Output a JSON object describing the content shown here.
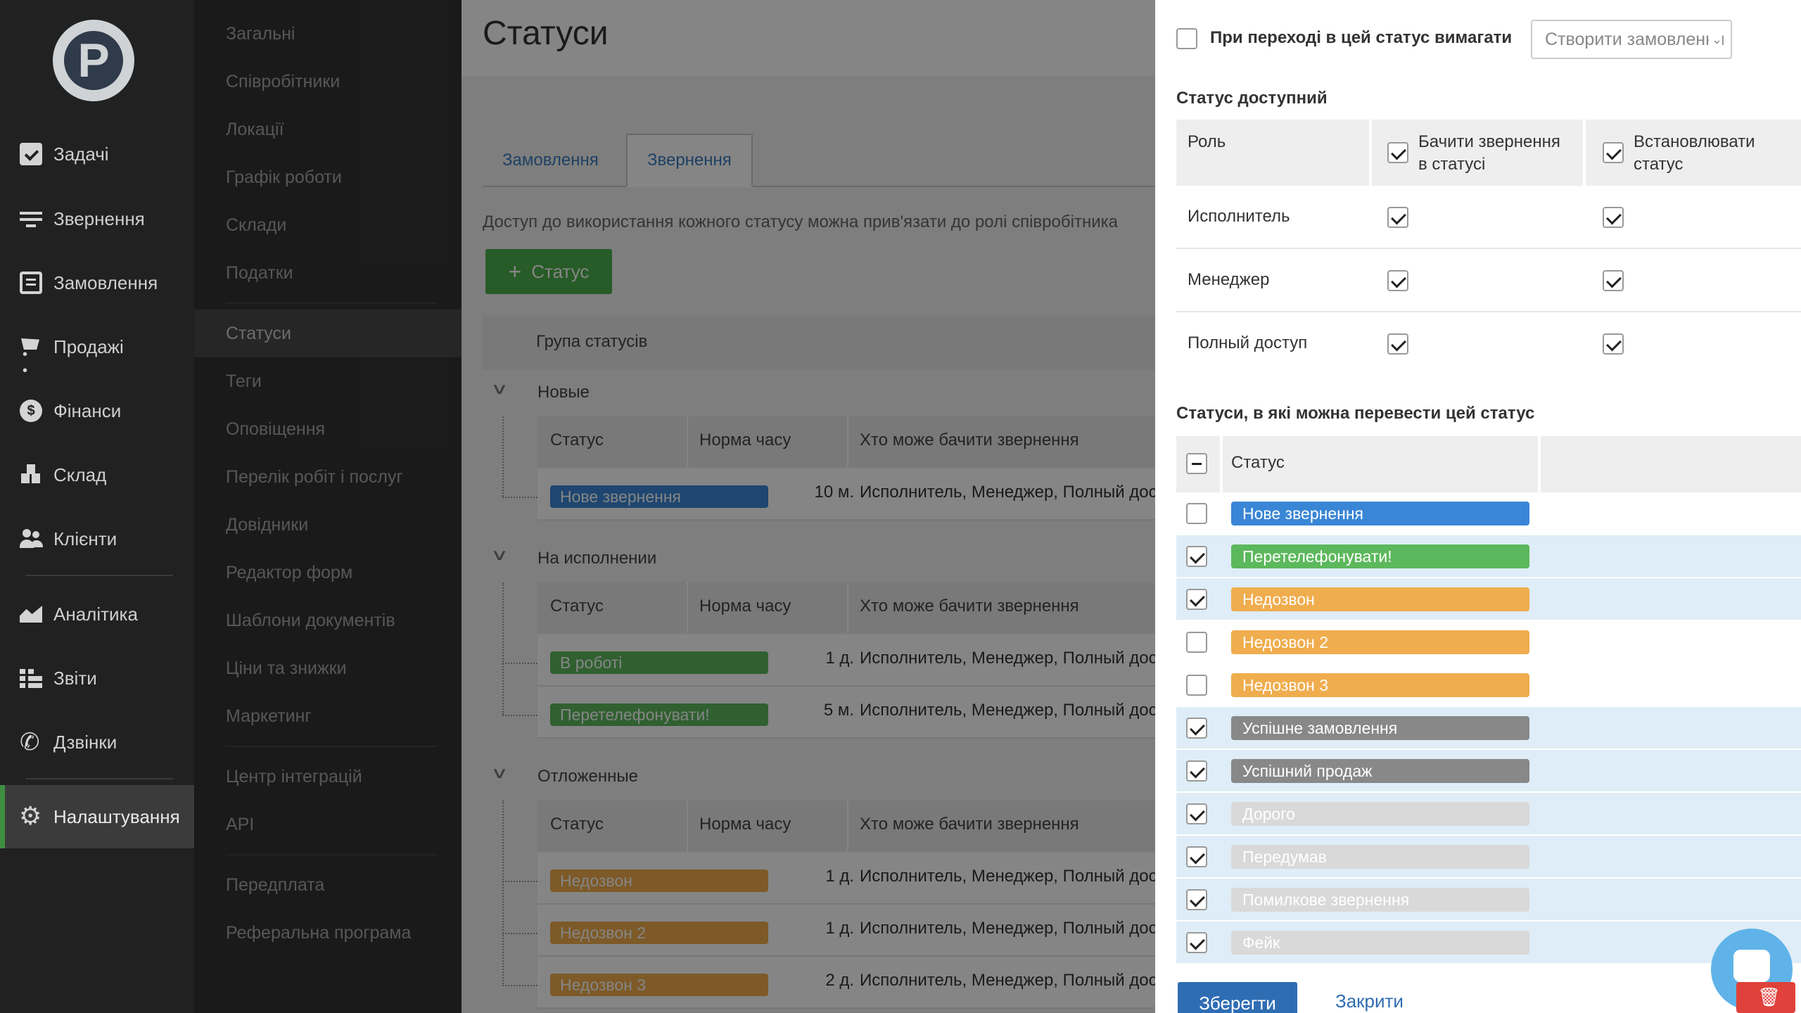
{
  "colors": {
    "accent_green": "#3e8e41",
    "blue": "#3a86d6",
    "green": "#5cb85c",
    "orange": "#f0ad4e",
    "grey_dark": "#888888",
    "grey_light": "#d9d9d9",
    "save_blue": "#2f6db3"
  },
  "nav": {
    "logo_icon": "logo-icon",
    "items": [
      {
        "label": "Задачі",
        "icon": "clipboard-check-icon"
      },
      {
        "label": "Звернення",
        "icon": "filter-icon"
      },
      {
        "label": "Замовлення",
        "icon": "document-icon"
      },
      {
        "label": "Продажі",
        "icon": "cart-icon"
      },
      {
        "label": "Фінанси",
        "icon": "coin-icon"
      },
      {
        "label": "Склад",
        "icon": "boxes-icon"
      },
      {
        "label": "Клієнти",
        "icon": "users-icon"
      },
      {
        "label": "Аналітика",
        "icon": "chart-icon"
      },
      {
        "label": "Звіти",
        "icon": "list-icon"
      },
      {
        "label": "Дзвінки",
        "icon": "phone-icon"
      },
      {
        "label": "Налаштування",
        "icon": "gear-icon"
      }
    ]
  },
  "submenu": {
    "items": [
      "Загальні",
      "Співробітники",
      "Локації",
      "Графік роботи",
      "Склади",
      "Податки",
      "Статуси",
      "Теги",
      "Оповіщення",
      "Перелік робіт і послуг",
      "Довідники",
      "Редактор форм",
      "Шаблони документів",
      "Ціни та знижки",
      "Маркетинг",
      "Центр інтеграцій",
      "API",
      "Передплата",
      "Реферальна програма"
    ],
    "active": "Статуси"
  },
  "main": {
    "title": "Статуси",
    "tabs": [
      "Замовлення",
      "Звернення"
    ],
    "active_tab": "Звернення",
    "help_text": "Доступ до використання кожного статусу можна прив'язати до ролі співробітника",
    "add_button": "Статус",
    "group_header": "Група статусів",
    "columns": {
      "status": "Статус",
      "norm": "Норма часу",
      "who": "Хто може бачити звернення"
    },
    "groups": [
      {
        "name": "Новые",
        "rows": [
          {
            "status": "Нове звернення",
            "color": "#3a86d6",
            "norm": "10 м.",
            "who": "Исполнитель, Менеджер, Полный доступ"
          }
        ]
      },
      {
        "name": "На исполнении",
        "rows": [
          {
            "status": "В роботі",
            "color": "#5cb85c",
            "norm": "1 д.",
            "who": "Исполнитель, Менеджер, Полный доступ"
          },
          {
            "status": "Перетелефонувати!",
            "color": "#5cb85c",
            "norm": "5 м.",
            "who": "Исполнитель, Менеджер, Полный доступ"
          }
        ]
      },
      {
        "name": "Отложенные",
        "rows": [
          {
            "status": "Недозвон",
            "color": "#f0ad4e",
            "norm": "1 д.",
            "who": "Исполнитель, Менеджер, Полный доступ"
          },
          {
            "status": "Недозвон 2",
            "color": "#f0ad4e",
            "norm": "1 д.",
            "who": "Исполнитель, Менеджер, Полный доступ"
          },
          {
            "status": "Недозвон 3",
            "color": "#f0ad4e",
            "norm": "2 д.",
            "who": "Исполнитель, Менеджер, Полный доступ"
          }
        ]
      }
    ]
  },
  "panel": {
    "require_label": "При переході в цей статус вимагати",
    "require_checked": false,
    "require_select": "Створити замовлення",
    "available_title": "Статус доступний",
    "role_col": "Роль",
    "see_col_line1": "Бачити звернення",
    "see_col_line2": "в статусі",
    "set_col_line1": "Встановлювати",
    "set_col_line2": "статус",
    "roles": [
      {
        "name": "Исполнитель",
        "see": true,
        "set": true
      },
      {
        "name": "Менеджер",
        "see": true,
        "set": true
      },
      {
        "name": "Полный доступ",
        "see": true,
        "set": true
      }
    ],
    "transitions_title": "Статуси, в які можна перевести цей статус",
    "status_col": "Статус",
    "statuses": [
      {
        "name": "Нове звернення",
        "color": "#3a86d6",
        "checked": false,
        "text": "#ffffff"
      },
      {
        "name": "Перетелефонувати!",
        "color": "#5cb85c",
        "checked": true,
        "text": "#ffffff"
      },
      {
        "name": "Недозвон",
        "color": "#f0ad4e",
        "checked": true,
        "text": "#ffffff"
      },
      {
        "name": "Недозвон 2",
        "color": "#f0ad4e",
        "checked": false,
        "text": "#ffffff"
      },
      {
        "name": "Недозвон 3",
        "color": "#f0ad4e",
        "checked": false,
        "text": "#ffffff"
      },
      {
        "name": "Успішне замовлення",
        "color": "#888888",
        "checked": true,
        "text": "#ffffff"
      },
      {
        "name": "Успішний продаж",
        "color": "#888888",
        "checked": true,
        "text": "#ffffff"
      },
      {
        "name": "Дорого",
        "color": "#d9d9d9",
        "checked": true,
        "text": "#ffffff"
      },
      {
        "name": "Передумав",
        "color": "#d9d9d9",
        "checked": true,
        "text": "#ffffff"
      },
      {
        "name": "Помилкове звернення",
        "color": "#d9d9d9",
        "checked": true,
        "text": "#ffffff"
      },
      {
        "name": "Фейк",
        "color": "#d9d9d9",
        "checked": true,
        "text": "#ffffff"
      }
    ],
    "save": "Зберегти",
    "close": "Закрити"
  }
}
